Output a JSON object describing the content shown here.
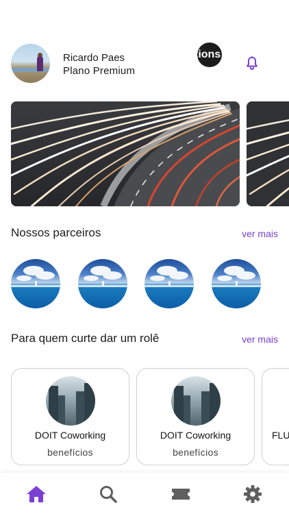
{
  "user": {
    "name": "Ricardo Paes",
    "plan": "Plano Premium"
  },
  "brand_badge": {
    "text": "tions",
    "color": "#1c1c1c"
  },
  "icons": {
    "notifications": "bell-icon",
    "nav": [
      "home-icon",
      "search-icon",
      "ticket-icon",
      "gear-icon"
    ]
  },
  "partners_section": {
    "title": "Nossos parceiros",
    "see_more": "ver mais",
    "count": 4
  },
  "outing_section": {
    "title": "Para quem curte dar um rolê",
    "see_more": "ver mais",
    "cards": [
      {
        "title": "DOIT Coworking",
        "subtitle": "benefícios"
      },
      {
        "title": "DOIT Coworking",
        "subtitle": "benefícios"
      },
      {
        "title": "FLU",
        "subtitle": ""
      }
    ]
  },
  "colors": {
    "accent": "#7a3fd3",
    "nav_active": "#7a3fd3",
    "nav_inactive": "#5f5f5f"
  }
}
